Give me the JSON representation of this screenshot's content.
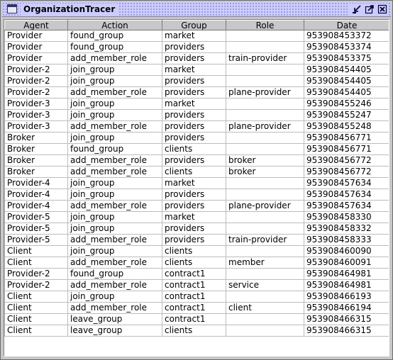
{
  "window": {
    "title": "OrganizationTracer"
  },
  "table": {
    "columns": [
      "Agent",
      "Action",
      "Group",
      "Role",
      "Date"
    ],
    "rows": [
      [
        "Provider",
        "found_group",
        "market",
        "",
        "953908453372"
      ],
      [
        "Provider",
        "found_group",
        "providers",
        "",
        "953908453374"
      ],
      [
        "Provider",
        "add_member_role",
        "providers",
        "train-provider",
        "953908453375"
      ],
      [
        "Provider-2",
        "join_group",
        "market",
        "",
        "953908454405"
      ],
      [
        "Provider-2",
        "join_group",
        "providers",
        "",
        "953908454405"
      ],
      [
        "Provider-2",
        "add_member_role",
        "providers",
        "plane-provider",
        "953908454405"
      ],
      [
        "Provider-3",
        "join_group",
        "market",
        "",
        "953908455246"
      ],
      [
        "Provider-3",
        "join_group",
        "providers",
        "",
        "953908455247"
      ],
      [
        "Provider-3",
        "add_member_role",
        "providers",
        "plane-provider",
        "953908455248"
      ],
      [
        "Broker",
        "join_group",
        "providers",
        "",
        "953908456771"
      ],
      [
        "Broker",
        "found_group",
        "clients",
        "",
        "953908456771"
      ],
      [
        "Broker",
        "add_member_role",
        "providers",
        "broker",
        "953908456772"
      ],
      [
        "Broker",
        "add_member_role",
        "clients",
        "broker",
        "953908456772"
      ],
      [
        "Provider-4",
        "join_group",
        "market",
        "",
        "953908457634"
      ],
      [
        "Provider-4",
        "join_group",
        "providers",
        "",
        "953908457634"
      ],
      [
        "Provider-4",
        "add_member_role",
        "providers",
        "plane-provider",
        "953908457634"
      ],
      [
        "Provider-5",
        "join_group",
        "market",
        "",
        "953908458330"
      ],
      [
        "Provider-5",
        "join_group",
        "providers",
        "",
        "953908458332"
      ],
      [
        "Provider-5",
        "add_member_role",
        "providers",
        "train-provider",
        "953908458333"
      ],
      [
        "Client",
        "join_group",
        "clients",
        "",
        "953908460090"
      ],
      [
        "Client",
        "add_member_role",
        "clients",
        "member",
        "953908460091"
      ],
      [
        "Provider-2",
        "found_group",
        "contract1",
        "",
        "953908464981"
      ],
      [
        "Provider-2",
        "add_member_role",
        "contract1",
        "service",
        "953908464981"
      ],
      [
        "Client",
        "join_group",
        "contract1",
        "",
        "953908466193"
      ],
      [
        "Client",
        "add_member_role",
        "contract1",
        "client",
        "953908466194"
      ],
      [
        "Client",
        "leave_group",
        "contract1",
        "",
        "953908466315"
      ],
      [
        "Client",
        "leave_group",
        "clients",
        "",
        "953908466315"
      ]
    ]
  },
  "icons": {
    "app": "window-icon",
    "minimize": "iconify-icon",
    "maximize": "maximize-icon",
    "close": "close-icon"
  }
}
